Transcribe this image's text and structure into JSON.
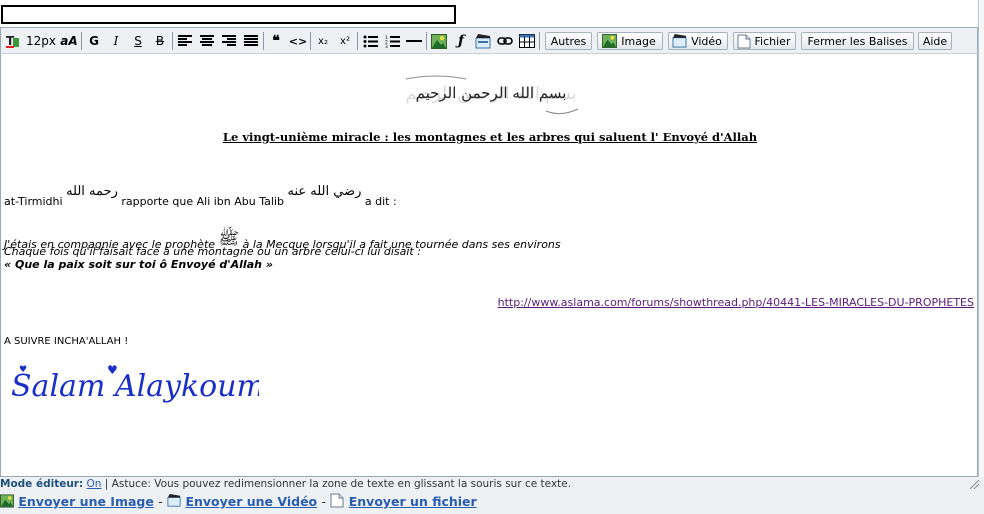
{
  "title_field": {
    "value": ""
  },
  "toolbar": {
    "font_size": "12px",
    "font_style": "aA",
    "bold": "G",
    "italic": "I",
    "underline": "S",
    "strike": "B",
    "quote": "66",
    "code": "<>",
    "sub": "x₂",
    "sup": "x²",
    "autres": "Autres",
    "image": "Image",
    "video": "Vidéo",
    "fichier": "Fichier",
    "fermer": "Fermer les Balises",
    "aide": "Aide"
  },
  "content": {
    "title": "Le vingt-unième miracle : les montagnes et les arbres qui saluent l' Envoyé d'Allah",
    "narrator": "at-Tirmidhi",
    "narrator_honor": "رحمه الله",
    "rapporte": "rapporte que Ali ibn Abu Talib",
    "ali_honor": "رضي الله عنه",
    "a_dit": "a dit :",
    "quote1a": "J'étais en compagnie avec le prophète",
    "prophet_honor": "ﷺ",
    "quote1b": "à la Mecque lorsqu'il a fait une tournée dans ses environs",
    "quote2": "Chaque fois qu'il faisait face à une montagne ou un arbre celui-ci lui disait :",
    "quote3": "« Que la paix soit sur toi ô Envoyé d'Allah »",
    "link": "http://www.aslama.com/forums/showthread.php/40441-LES-MIRACLES-DU-PROPHETES",
    "suivre": "A SUIVRE INCHA'ALLAH !",
    "salam": "Salam Alaykoum !",
    "bismillah": "بسم الله الرحمن الرحيم"
  },
  "footer": {
    "mode_label": "Mode éditeur:",
    "mode_value": "On",
    "tip": "| Astuce: Vous pouvez redimensionner la zone de texte en glissant la souris sur ce texte.",
    "send_image": "Envoyer une Image",
    "send_video": "Envoyer une Vidéo",
    "send_file": "Envoyer un fichier",
    "dash": "-"
  }
}
